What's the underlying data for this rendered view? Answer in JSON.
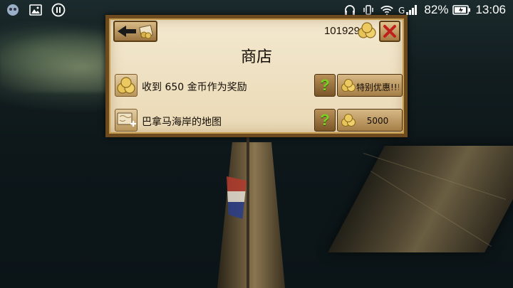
{
  "status_bar": {
    "left_icons": [
      "notification-icon",
      "gallery-icon",
      "pause-icon"
    ],
    "battery_text": "82%",
    "time": "13:06"
  },
  "shop": {
    "title": "商店",
    "gold_balance": "101929",
    "items": [
      {
        "label": "收到 650 金币作为奖励",
        "icon": "gold-coins-icon",
        "button_label": "特别优惠!!!"
      },
      {
        "label": "巴拿马海岸的地图",
        "icon": "map-add-icon",
        "button_label": "5000"
      }
    ]
  },
  "colors": {
    "panel_bg": "#ead9b5",
    "panel_border": "#6d4a1e",
    "close_x": "#c0201b",
    "info_question": "#7ccf22"
  }
}
